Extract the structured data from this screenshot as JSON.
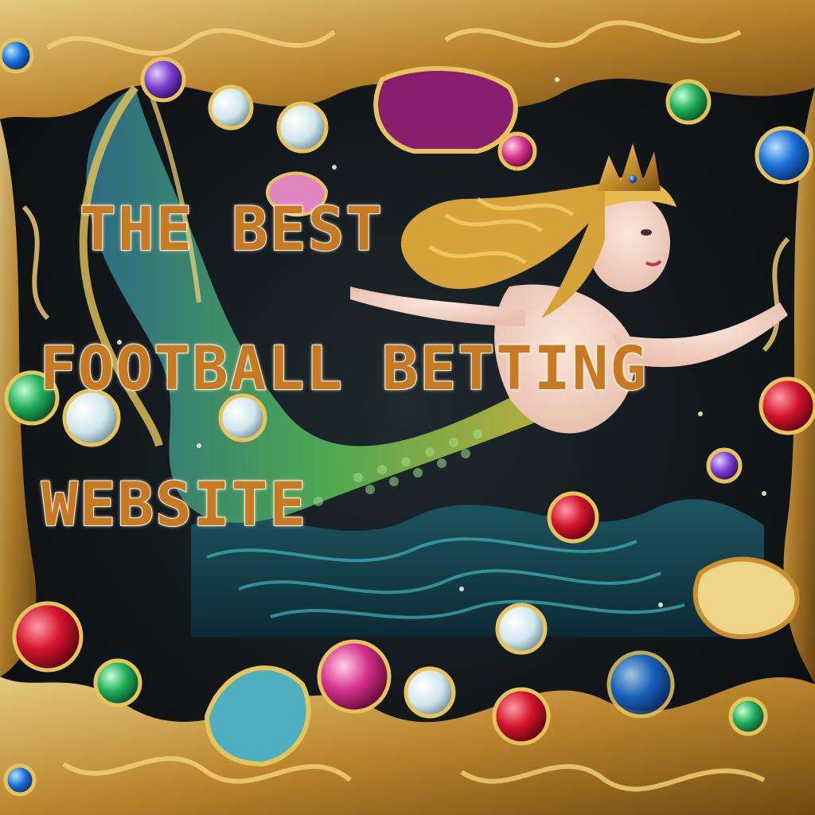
{
  "caption": {
    "line1": "THE BEST",
    "line2": "FOOTBALL BETTING",
    "line3": "WEBSITE"
  },
  "colors": {
    "caption_fill": "#c77a22",
    "caption_outline": "#f4ead8",
    "gold": "#d9a441",
    "background": "#141a1d",
    "sea": "#1f6f78",
    "tail": "#3fa35a"
  },
  "subject": {
    "figure": "mermaid-illustration",
    "decor": [
      "gold-filigree-frame",
      "gemstones",
      "seashells",
      "waves"
    ]
  }
}
